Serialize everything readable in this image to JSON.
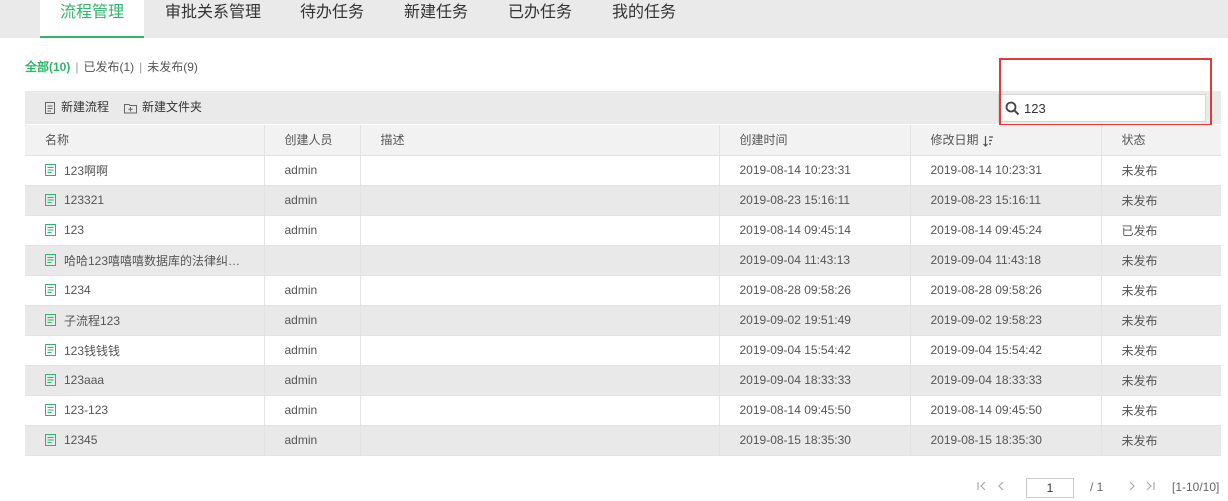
{
  "nav": {
    "tabs": [
      {
        "label": "流程管理"
      },
      {
        "label": "审批关系管理"
      },
      {
        "label": "待办任务"
      },
      {
        "label": "新建任务"
      },
      {
        "label": "已办任务"
      },
      {
        "label": "我的任务"
      }
    ]
  },
  "filters": {
    "all": "全部(10)",
    "published": "已发布(1)",
    "unpublished": "未发布(9)",
    "separator": "|"
  },
  "toolbar": {
    "new_flow": "新建流程",
    "new_folder": "新建文件夹"
  },
  "search": {
    "value": "123"
  },
  "table": {
    "headers": {
      "name": "名称",
      "creator": "创建人员",
      "desc": "描述",
      "created": "创建时间",
      "modified": "修改日期",
      "status": "状态"
    },
    "rows": [
      {
        "name": "123啊啊",
        "creator": "admin",
        "desc": "",
        "created": "2019-08-14 10:23:31",
        "modified": "2019-08-14 10:23:31",
        "status": "未发布"
      },
      {
        "name": "123321",
        "creator": "admin",
        "desc": "",
        "created": "2019-08-23 15:16:11",
        "modified": "2019-08-23 15:16:11",
        "status": "未发布"
      },
      {
        "name": "123",
        "creator": "admin",
        "desc": "",
        "created": "2019-08-14 09:45:14",
        "modified": "2019-08-14 09:45:24",
        "status": "已发布"
      },
      {
        "name": "哈哈123嘻嘻嘻数据库的法律纠…",
        "creator": "",
        "desc": "",
        "created": "2019-09-04 11:43:13",
        "modified": "2019-09-04 11:43:18",
        "status": "未发布"
      },
      {
        "name": "1234",
        "creator": "admin",
        "desc": "",
        "created": "2019-08-28 09:58:26",
        "modified": "2019-08-28 09:58:26",
        "status": "未发布"
      },
      {
        "name": "子流程123",
        "creator": "admin",
        "desc": "",
        "created": "2019-09-02 19:51:49",
        "modified": "2019-09-02 19:58:23",
        "status": "未发布"
      },
      {
        "name": "123钱钱钱",
        "creator": "admin",
        "desc": "",
        "created": "2019-09-04 15:54:42",
        "modified": "2019-09-04 15:54:42",
        "status": "未发布"
      },
      {
        "name": "123aaa",
        "creator": "admin",
        "desc": "",
        "created": "2019-09-04 18:33:33",
        "modified": "2019-09-04 18:33:33",
        "status": "未发布"
      },
      {
        "name": "123-123",
        "creator": "admin",
        "desc": "",
        "created": "2019-08-14 09:45:50",
        "modified": "2019-08-14 09:45:50",
        "status": "未发布"
      },
      {
        "name": "12345",
        "creator": "admin",
        "desc": "",
        "created": "2019-08-15 18:35:30",
        "modified": "2019-08-15 18:35:30",
        "status": "未发布"
      }
    ]
  },
  "pager": {
    "current_page": "1",
    "total": "/ 1",
    "range": "[1-10/10]"
  },
  "colors": {
    "accent": "#2fb66a",
    "highlight_box": "#e4393c"
  }
}
